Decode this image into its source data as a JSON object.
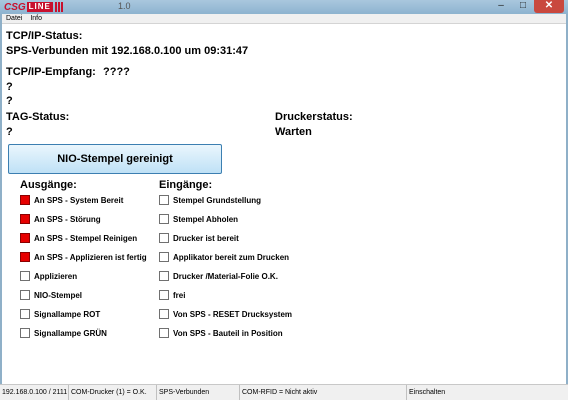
{
  "window": {
    "logo_csg": "CSG",
    "logo_line": "LINE",
    "title": "1.0",
    "minimize": "–",
    "maximize": "□",
    "close": "✕"
  },
  "menu": [
    "Datei",
    "Info"
  ],
  "status": {
    "tcpip_label": "TCP/IP-Status:",
    "tcpip_value": "SPS-Verbunden mit 192.168.0.100 um 09:31:47",
    "empfang_label": "TCP/IP-Empfang:",
    "empfang_value": "????",
    "line1": "?",
    "line2": "?",
    "tag_label": "TAG-Status:",
    "tag_value": "?",
    "drucker_label": "Druckerstatus:",
    "drucker_value": "Warten"
  },
  "button": {
    "label": "NIO-Stempel gereinigt"
  },
  "ausgaenge": {
    "heading": "Ausgänge:",
    "items": [
      {
        "label": "An SPS - System Bereit",
        "checked": true
      },
      {
        "label": "An SPS - Störung",
        "checked": true
      },
      {
        "label": "An SPS - Stempel Reinigen",
        "checked": true
      },
      {
        "label": "An SPS - Applizieren ist fertig",
        "checked": true
      },
      {
        "label": "Applizieren",
        "checked": false
      },
      {
        "label": "NIO-Stempel",
        "checked": false
      },
      {
        "label": "Signallampe ROT",
        "checked": false
      },
      {
        "label": "Signallampe GRÜN",
        "checked": false
      }
    ]
  },
  "eingaenge": {
    "heading": "Eingänge:",
    "items": [
      {
        "label": "Stempel Grundstellung",
        "checked": false
      },
      {
        "label": "Stempel Abholen",
        "checked": false
      },
      {
        "label": "Drucker ist bereit",
        "checked": false
      },
      {
        "label": "Applikator bereit zum Drucken",
        "checked": false
      },
      {
        "label": "Drucker /Material-Folie O.K.",
        "checked": false
      },
      {
        "label": "frei",
        "checked": false
      },
      {
        "label": "Von SPS - RESET Drucksystem",
        "checked": false
      },
      {
        "label": "Von SPS - Bauteil in Position",
        "checked": false
      }
    ]
  },
  "statusbar": {
    "ip": "192.168.0.100 / 2111",
    "com_drucker": "COM-Drucker (1) = O.K.",
    "sps": "SPS-Verbunden",
    "com_rfid": "COM-RFID = Nicht aktiv",
    "mode": "Einschalten"
  },
  "colors": {
    "active": "#e60000",
    "accent": "#3c7fb1"
  }
}
